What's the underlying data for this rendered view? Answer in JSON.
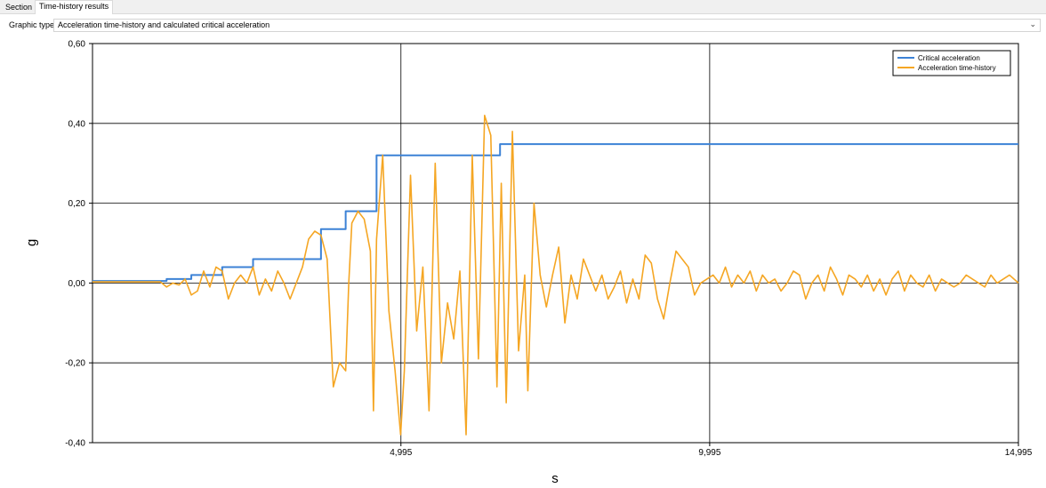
{
  "tabs": [
    {
      "label": "Section",
      "active": false
    },
    {
      "label": "Time-history results",
      "active": true
    }
  ],
  "graphic_type": {
    "label": "Graphic type",
    "selected": "Acceleration time-history and calculated critical acceleration",
    "chevron_icon": "chevron-down-icon"
  },
  "chart_data": {
    "type": "line",
    "xlabel": "s",
    "ylabel": "g",
    "xlim": [
      0,
      14.995
    ],
    "ylim": [
      -0.4,
      0.6
    ],
    "x_ticks": [
      4.995,
      9.995,
      14.995
    ],
    "x_tick_labels": [
      "4,995",
      "9,995",
      "14,995"
    ],
    "y_ticks": [
      -0.4,
      -0.2,
      0.0,
      0.2,
      0.4,
      0.6
    ],
    "y_tick_labels": [
      "-0,40",
      "-0,20",
      "0,00",
      "0,20",
      "0,40",
      "0,60"
    ],
    "grid": true,
    "legend_position": "top-right",
    "series": [
      {
        "name": "Critical acceleration",
        "color": "#3c82d6",
        "step": true,
        "x": [
          0,
          1.2,
          1.6,
          2.1,
          2.6,
          3.7,
          4.1,
          4.6,
          6.6,
          14.995
        ],
        "values": [
          0.005,
          0.01,
          0.02,
          0.04,
          0.06,
          0.135,
          0.18,
          0.32,
          0.348,
          0.348
        ]
      },
      {
        "name": "Acceleration time-history",
        "color": "#f5a623",
        "step": false,
        "x": [
          0,
          1.1,
          1.2,
          1.3,
          1.4,
          1.5,
          1.6,
          1.7,
          1.8,
          1.9,
          2.0,
          2.1,
          2.2,
          2.3,
          2.4,
          2.5,
          2.6,
          2.7,
          2.8,
          2.9,
          3.0,
          3.1,
          3.2,
          3.3,
          3.4,
          3.5,
          3.6,
          3.7,
          3.8,
          3.9,
          4.0,
          4.1,
          4.15,
          4.2,
          4.3,
          4.4,
          4.5,
          4.55,
          4.6,
          4.7,
          4.8,
          4.9,
          4.99,
          5.05,
          5.15,
          5.25,
          5.35,
          5.45,
          5.55,
          5.65,
          5.75,
          5.85,
          5.95,
          6.05,
          6.15,
          6.25,
          6.35,
          6.45,
          6.55,
          6.62,
          6.7,
          6.8,
          6.9,
          7.0,
          7.05,
          7.15,
          7.25,
          7.35,
          7.45,
          7.55,
          7.65,
          7.75,
          7.85,
          7.95,
          8.05,
          8.15,
          8.25,
          8.35,
          8.45,
          8.55,
          8.65,
          8.75,
          8.85,
          8.95,
          9.05,
          9.15,
          9.25,
          9.35,
          9.45,
          9.55,
          9.65,
          9.75,
          9.85,
          9.95,
          10.05,
          10.15,
          10.25,
          10.35,
          10.45,
          10.55,
          10.65,
          10.75,
          10.85,
          10.95,
          11.05,
          11.15,
          11.25,
          11.35,
          11.45,
          11.55,
          11.65,
          11.75,
          11.85,
          11.95,
          12.05,
          12.15,
          12.25,
          12.35,
          12.45,
          12.55,
          12.65,
          12.75,
          12.85,
          12.95,
          13.05,
          13.15,
          13.25,
          13.35,
          13.45,
          13.55,
          13.65,
          13.75,
          13.85,
          13.95,
          14.05,
          14.15,
          14.25,
          14.35,
          14.45,
          14.55,
          14.65,
          14.75,
          14.85,
          14.995
        ],
        "values": [
          0.003,
          0.003,
          -0.01,
          0.0,
          -0.005,
          0.01,
          -0.03,
          -0.02,
          0.03,
          -0.01,
          0.04,
          0.03,
          -0.04,
          0.0,
          0.02,
          0.0,
          0.04,
          -0.03,
          0.01,
          -0.02,
          0.03,
          0.0,
          -0.04,
          0.0,
          0.04,
          0.11,
          0.13,
          0.12,
          0.06,
          -0.26,
          -0.2,
          -0.22,
          0.0,
          0.15,
          0.18,
          0.16,
          0.08,
          -0.32,
          0.11,
          0.32,
          -0.07,
          -0.22,
          -0.38,
          -0.22,
          0.27,
          -0.12,
          0.04,
          -0.32,
          0.3,
          -0.2,
          -0.05,
          -0.14,
          0.03,
          -0.38,
          0.32,
          -0.19,
          0.42,
          0.37,
          -0.26,
          0.25,
          -0.3,
          0.38,
          -0.17,
          0.02,
          -0.27,
          0.2,
          0.02,
          -0.06,
          0.02,
          0.09,
          -0.1,
          0.02,
          -0.04,
          0.06,
          0.02,
          -0.02,
          0.02,
          -0.04,
          -0.01,
          0.03,
          -0.05,
          0.01,
          -0.04,
          0.07,
          0.05,
          -0.04,
          -0.09,
          0.0,
          0.08,
          0.06,
          0.04,
          -0.03,
          0.0,
          0.01,
          0.02,
          0.0,
          0.04,
          -0.01,
          0.02,
          0.0,
          0.03,
          -0.02,
          0.02,
          0.0,
          0.01,
          -0.02,
          0.0,
          0.03,
          0.02,
          -0.04,
          0.0,
          0.02,
          -0.02,
          0.04,
          0.01,
          -0.03,
          0.02,
          0.01,
          -0.01,
          0.02,
          -0.02,
          0.01,
          -0.03,
          0.01,
          0.03,
          -0.02,
          0.02,
          0.0,
          -0.01,
          0.02,
          -0.02,
          0.01,
          0.0,
          -0.01,
          0.0,
          0.02,
          0.01,
          0.0,
          -0.01,
          0.02,
          0.0,
          0.01,
          0.02,
          0.0
        ]
      }
    ]
  }
}
